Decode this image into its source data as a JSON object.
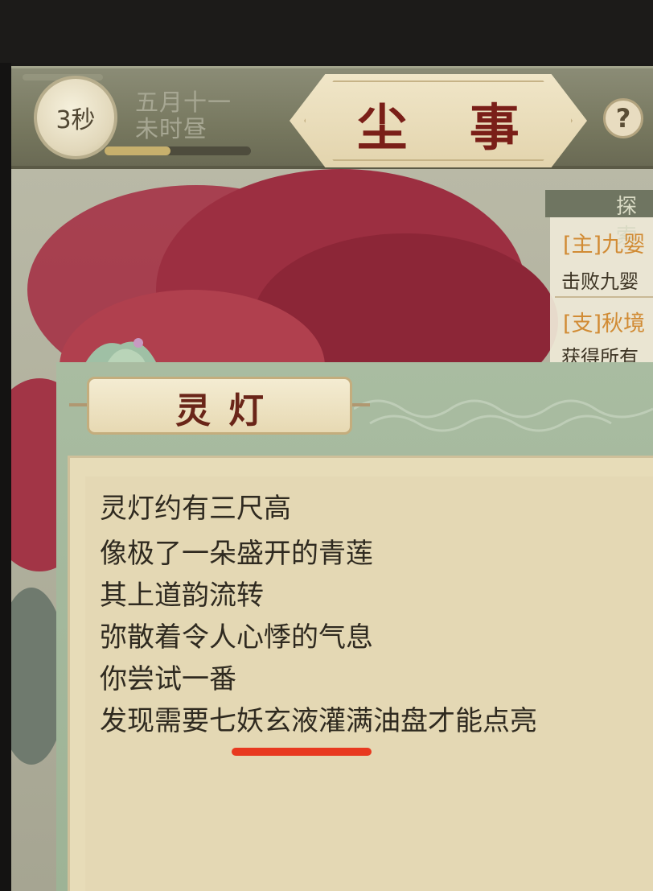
{
  "header": {
    "timer": "3秒",
    "date_line1": "五月十一",
    "date_line2": "未时昼",
    "title": "尘  事",
    "help": "?",
    "progress": 0.45
  },
  "quest_panel": {
    "header": "探索",
    "main_quest": "[主]九婴",
    "main_desc": "击败九婴",
    "side_quest": "[支]秋境",
    "side_desc": "获得所有"
  },
  "dialog": {
    "title": "灵灯",
    "lines": [
      "灵灯约有三尺高",
      "像极了一朵盛开的青莲",
      "其上道韵流转",
      "弥散着令人心悸的气息",
      "你尝试一番",
      "发现需要七妖玄液灌满油盘才能点亮"
    ]
  },
  "colors": {
    "title_red": "#7a1f18",
    "quest_orange": "#d18b34",
    "highlight_red": "#e8391f"
  }
}
